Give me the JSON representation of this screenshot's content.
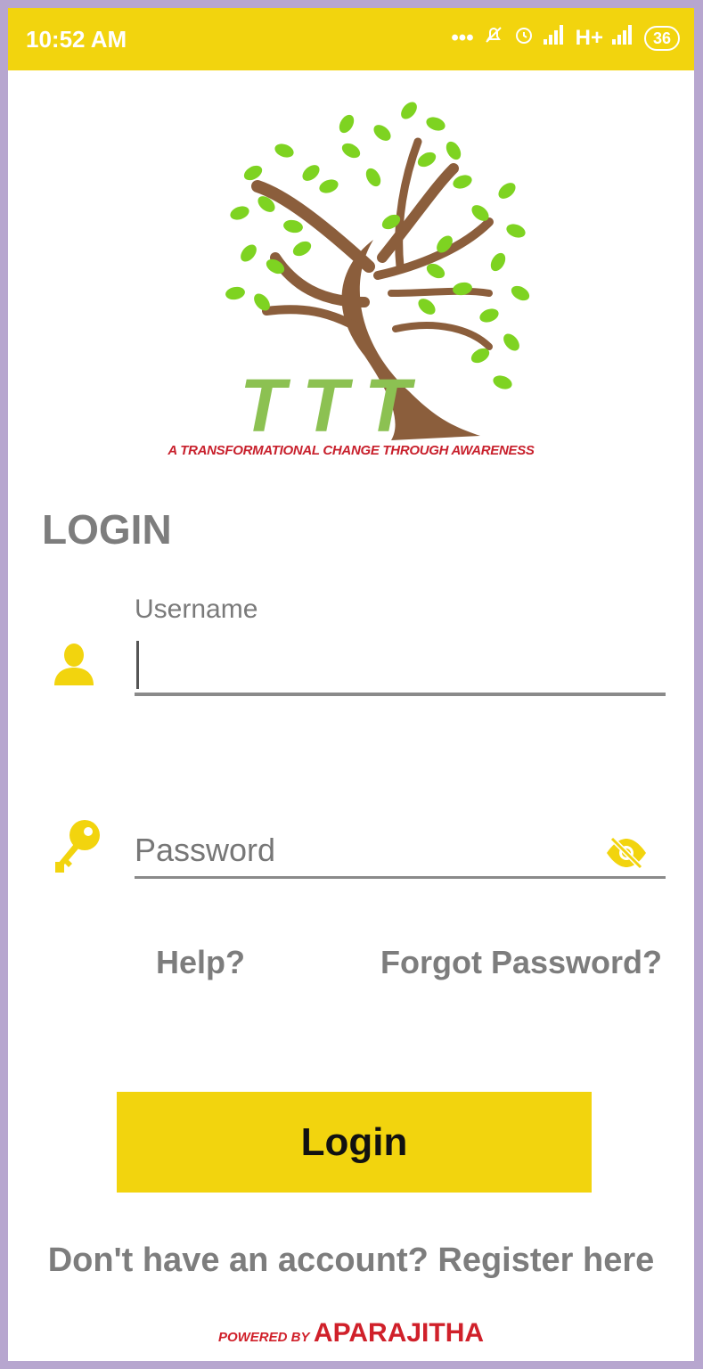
{
  "statusbar": {
    "time": "10:52 AM",
    "network": "H+",
    "battery": "36"
  },
  "logo": {
    "letters": [
      "T",
      "T",
      "T"
    ],
    "tagline": "A TRANSFORMATIONAL CHANGE THROUGH AWARENESS"
  },
  "form": {
    "title": "LOGIN",
    "username_label": "Username",
    "username_value": "",
    "password_placeholder": "Password",
    "password_value": ""
  },
  "links": {
    "help": "Help?",
    "forgot": "Forgot Password?",
    "register": "Don't have an account? Register here"
  },
  "button": {
    "login": "Login"
  },
  "footer": {
    "powered_by": "POWERED BY",
    "brand": "APARAJITHA"
  },
  "colors": {
    "accent": "#f2d40e",
    "brand_red": "#d0202a",
    "text_gray": "#7d7d7d",
    "frame": "#b7a6cf"
  },
  "icons": [
    "user-icon",
    "key-icon",
    "eye-off-icon",
    "alarm-icon",
    "signal-icon",
    "battery-icon"
  ]
}
